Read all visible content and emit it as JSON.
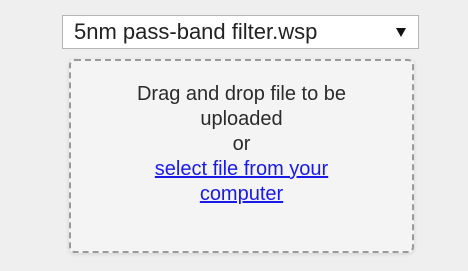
{
  "file_select": {
    "selected_value": "5nm pass-band filter.wsp",
    "chevron_icon": "chevron-down-icon"
  },
  "drop_zone": {
    "instruction": "Drag and drop file to be uploaded",
    "or_text": "or",
    "select_link": "select file from your computer"
  }
}
